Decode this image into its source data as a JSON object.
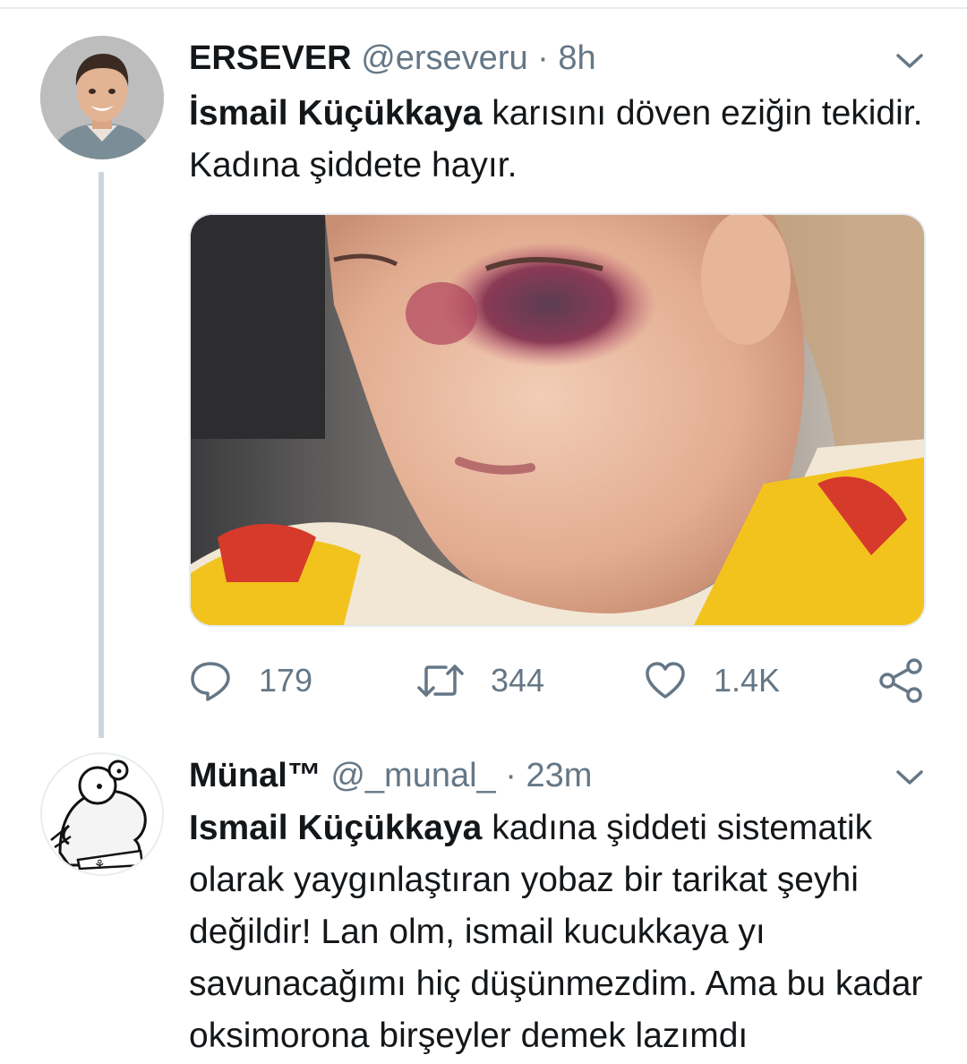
{
  "tweets": [
    {
      "name": "ERSEVER",
      "handle": "@erseveru",
      "separator": "·",
      "time": "8h",
      "mention": "İsmail Küçükkaya",
      "text": " karısını döven eziğin tekidir. Kadına şiddete hayır.",
      "stats": {
        "replies": "179",
        "retweets": "344",
        "likes": "1.4K"
      }
    },
    {
      "name": "Münal™",
      "handle": "@_munal_",
      "separator": "·",
      "time": "23m",
      "mention": "Ismail Küçükkaya",
      "text": " kadına şiddeti sistematik olarak yaygınlaştıran yobaz bir tarikat şeyhi değildir! Lan olm, ismail kucukkaya yı savunacağımı hiç düşünmezdim. Ama bu kadar oksimorona birşeyler demek lazımdı"
    }
  ],
  "icons": {
    "reply": "reply-icon",
    "retweet": "retweet-icon",
    "like": "heart-icon",
    "share": "share-icon",
    "menu": "chevron-down-icon"
  },
  "colors": {
    "text": "#14171a",
    "secondary": "#657786",
    "thread_line": "#ccd6dd",
    "divider": "#e6ecf0"
  }
}
